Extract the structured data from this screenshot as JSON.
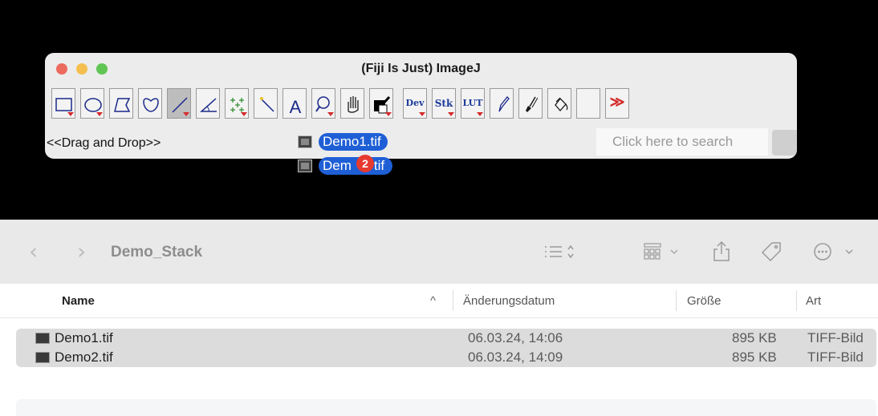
{
  "imagej": {
    "title": "(Fiji Is Just) ImageJ",
    "status_text": "<<Drag and Drop>>",
    "search_placeholder": "Click here to search",
    "tools": {
      "dev": "Dev",
      "stk": "Stk",
      "lut": "LUT",
      "more": "≫"
    }
  },
  "drag": {
    "item1": "Demo1.tif",
    "item2_pre": "Dem",
    "item2_post": "tif",
    "count": "2"
  },
  "finder": {
    "folder": "Demo_Stack",
    "columns": {
      "name": "Name",
      "date": "Änderungsdatum",
      "size": "Größe",
      "kind": "Art"
    },
    "files": [
      {
        "name": "Demo1.tif",
        "date": "06.03.24, 14:06",
        "size": "895 KB",
        "kind": "TIFF-Bild"
      },
      {
        "name": "Demo2.tif",
        "date": "06.03.24, 14:09",
        "size": "895 KB",
        "kind": "TIFF-Bild"
      }
    ]
  },
  "colors": {
    "selection_blue": "#1f5fd6",
    "badge_red": "#e63a30",
    "tool_triangle": "#d42b2b"
  }
}
